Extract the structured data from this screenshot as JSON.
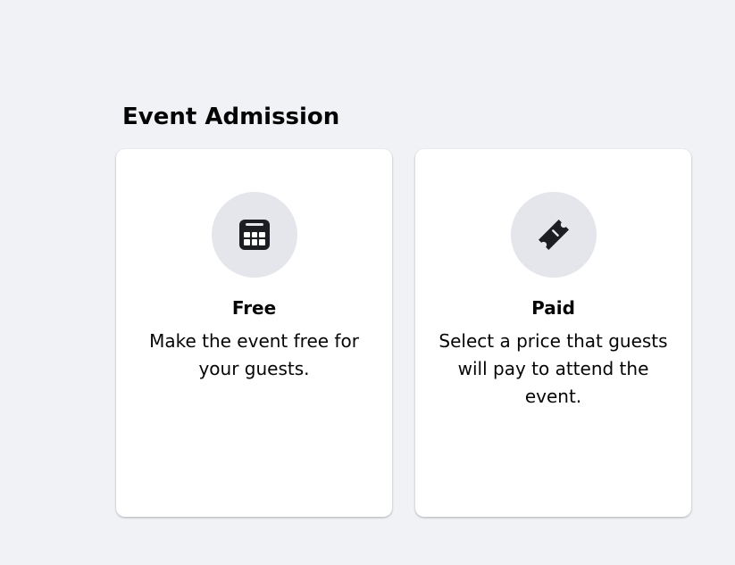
{
  "section": {
    "title": "Event Admission"
  },
  "options": [
    {
      "id": "free",
      "icon": "calendar-icon",
      "title": "Free",
      "description": "Make the event free for your guests."
    },
    {
      "id": "paid",
      "icon": "ticket-icon",
      "title": "Paid",
      "description": "Select a price that guests will pay to attend the event."
    }
  ],
  "colors": {
    "background": "#f0f2f5",
    "card": "#ffffff",
    "icon_circle": "#e4e6eb",
    "icon": "#1c1e21",
    "text": "#050505"
  }
}
